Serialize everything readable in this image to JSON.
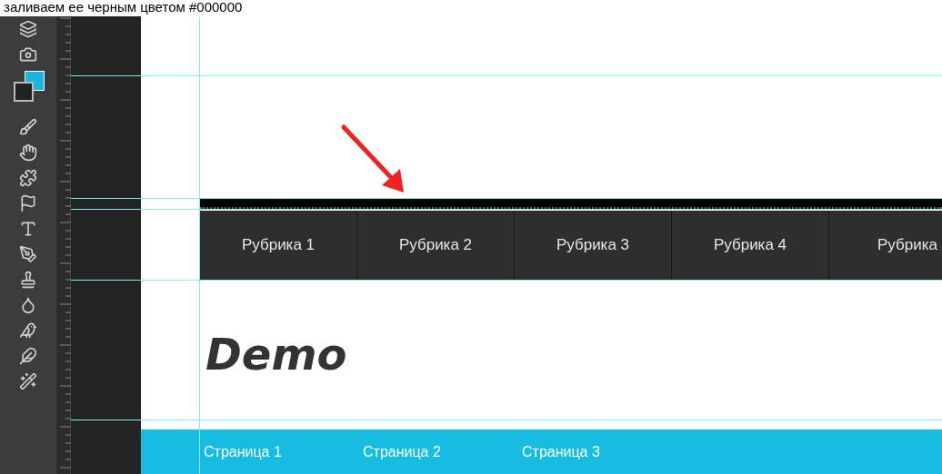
{
  "caption": "заливаем ее черным цветом #000000",
  "menu": {
    "items": [
      {
        "label": "Рубрика 1"
      },
      {
        "label": "Рубрика 2"
      },
      {
        "label": "Рубрика 3"
      },
      {
        "label": "Рубрика 4"
      },
      {
        "label": "Рубрика"
      }
    ]
  },
  "logo": "Demo",
  "pages": {
    "items": [
      {
        "label": "Страница 1"
      },
      {
        "label": "Страница 2"
      },
      {
        "label": "Страница 3"
      }
    ]
  }
}
